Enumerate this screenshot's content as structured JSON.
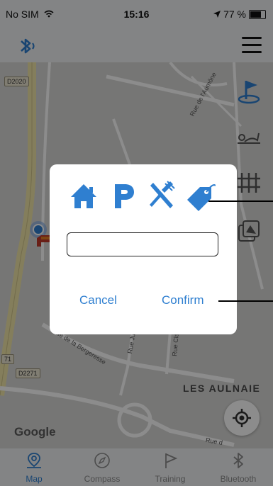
{
  "status_bar": {
    "carrier": "No SIM",
    "time": "15:16",
    "battery": "77 %"
  },
  "map": {
    "road_d2020": "D2020",
    "road_d2271": "D2271",
    "road_71": "71",
    "street_aumone": "Rue de l'Aumône",
    "street_bergeresse": "Rue de la Bergeresse",
    "street_juine": "Rue Juine",
    "street_clatz": "Rue Clatz",
    "street_rue_d": "Rue d",
    "place_name": "LES AULNAIE",
    "google_logo": "Google"
  },
  "dialog": {
    "input_value": "",
    "input_placeholder": "",
    "cancel_label": "Cancel",
    "confirm_label": "Confirm"
  },
  "tabbar": [
    {
      "label": "Map",
      "icon": "map-pin-icon",
      "active": true
    },
    {
      "label": "Compass",
      "icon": "compass-icon",
      "active": false
    },
    {
      "label": "Training",
      "icon": "flag-icon",
      "active": false
    },
    {
      "label": "Bluetooth",
      "icon": "bluetooth-icon",
      "active": false
    }
  ],
  "colors": {
    "accent": "#2f7fd0",
    "overlay": "#000000",
    "marker_red": "#c0392b"
  }
}
